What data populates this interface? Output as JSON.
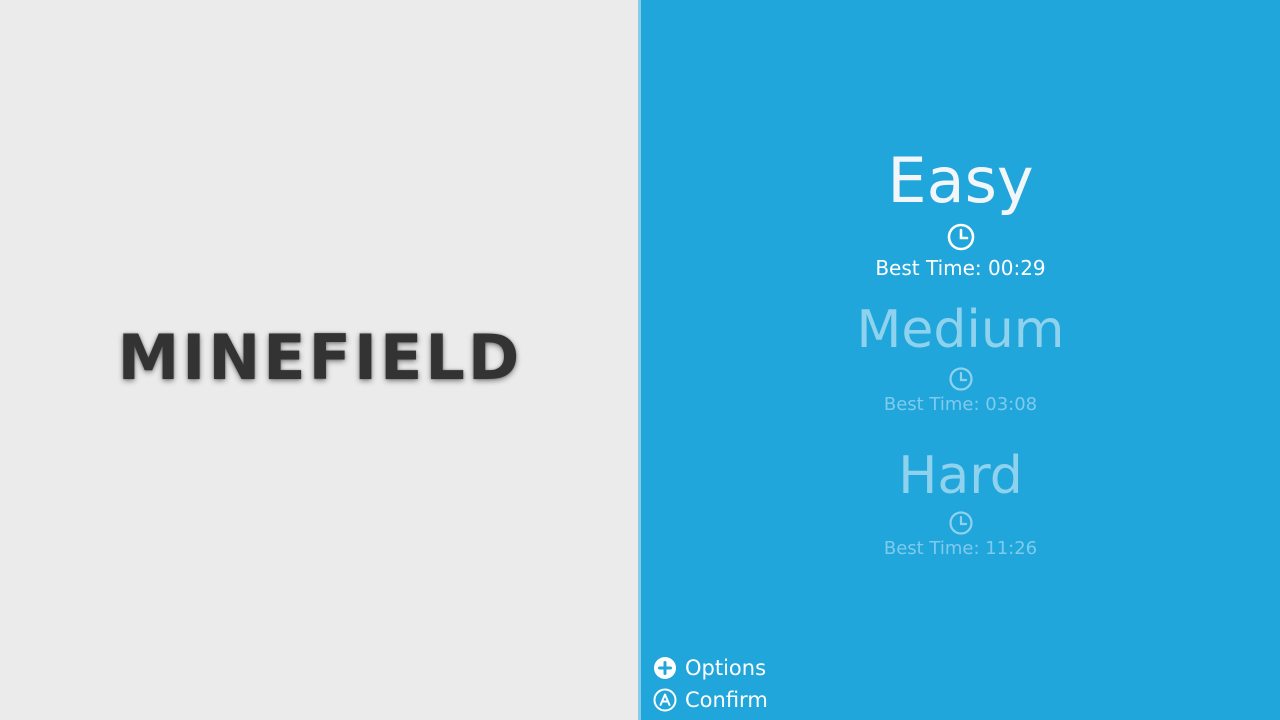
{
  "title": "MINEFIELD",
  "difficulties": [
    {
      "name": "Easy",
      "best_time": "Best Time: 00:29",
      "selected": true
    },
    {
      "name": "Medium",
      "best_time": "Best Time: 03:08",
      "selected": false
    },
    {
      "name": "Hard",
      "best_time": "Best Time: 11:26",
      "selected": false
    }
  ],
  "controls": {
    "options": {
      "label": "Options",
      "icon": "plus-button-icon"
    },
    "confirm": {
      "label": "Confirm",
      "icon": "a-button-icon"
    }
  },
  "colors": {
    "left_background": "#ebebeb",
    "right_background": "#21a6dc",
    "title_text": "#333333",
    "selected_text": "#ffffff",
    "unselected_text": "#8fd2ee"
  }
}
